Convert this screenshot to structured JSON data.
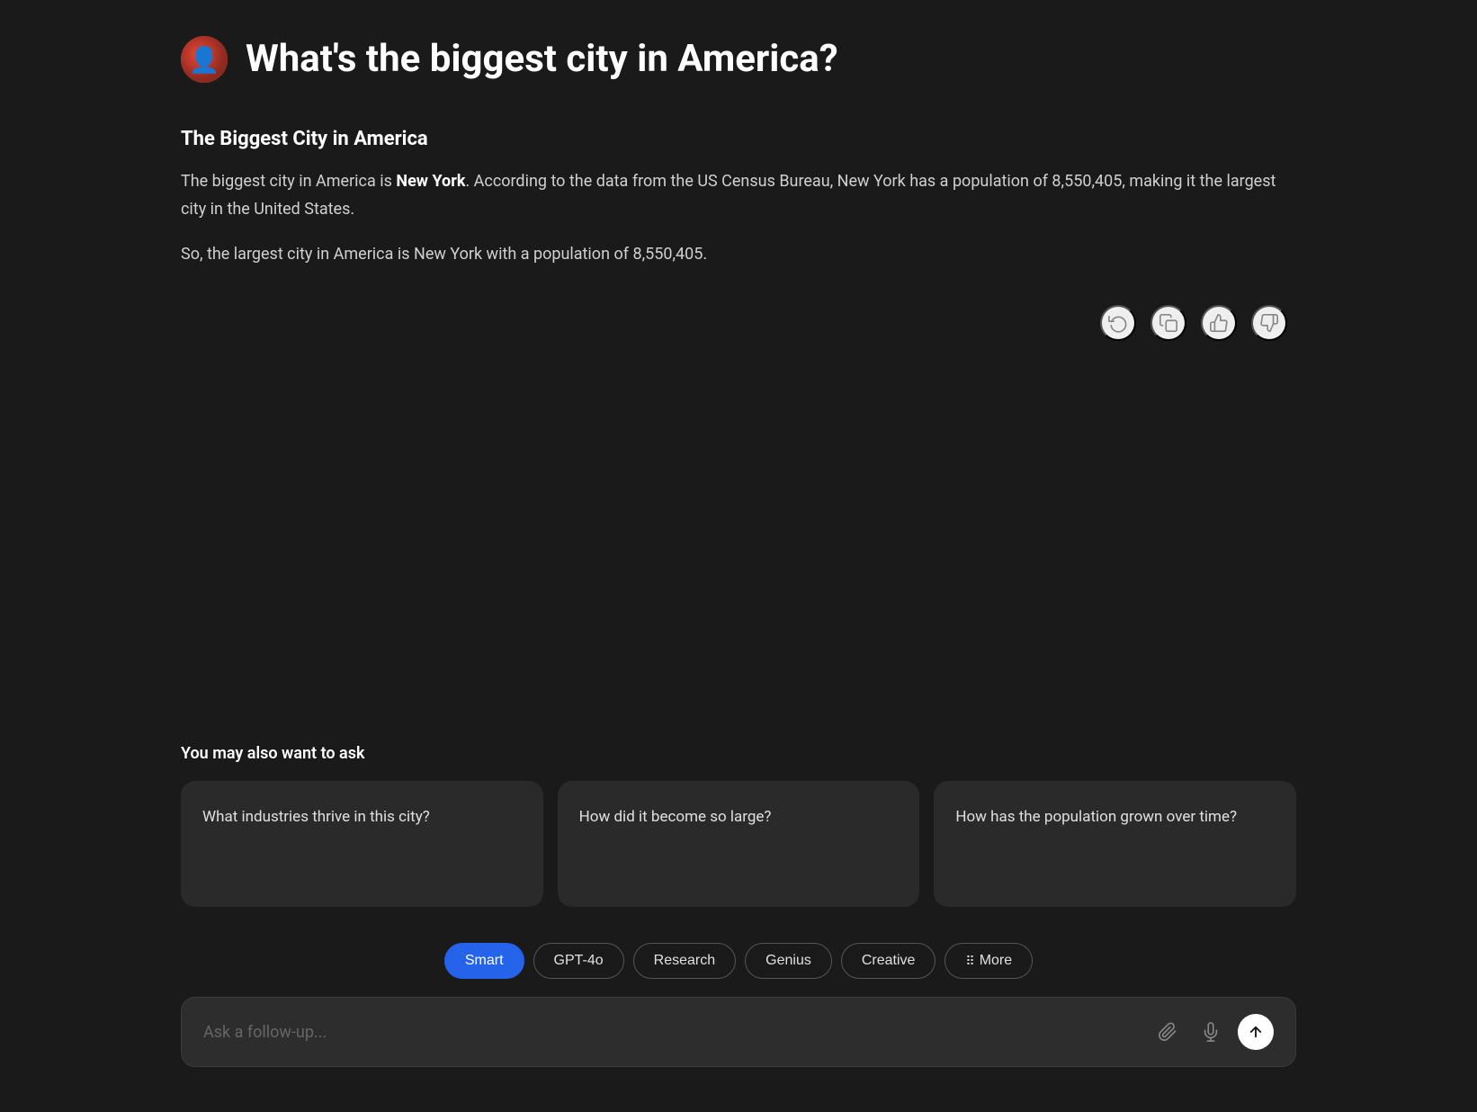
{
  "header": {
    "question": "What's the biggest city in America?"
  },
  "answer": {
    "heading": "The Biggest City in America",
    "paragraph1_before": "The biggest city in America is ",
    "paragraph1_bold": "New York",
    "paragraph1_after": ". According to the data from the US Census Bureau, New York has a population of 8,550,405, making it the largest city in the United States.",
    "paragraph2": "So, the largest city in America is New York with a population of 8,550,405."
  },
  "action_icons": {
    "regenerate": "regenerate-icon",
    "copy": "copy-icon",
    "thumbs_up": "thumbs-up-icon",
    "thumbs_down": "thumbs-down-icon"
  },
  "suggestions": {
    "title": "You may also want to ask",
    "items": [
      {
        "text": "What industries thrive in this city?"
      },
      {
        "text": "How did it become so large?"
      },
      {
        "text": "How has the population grown over time?"
      }
    ]
  },
  "model_buttons": [
    {
      "id": "smart",
      "label": "Smart",
      "active": true
    },
    {
      "id": "gpt4o",
      "label": "GPT-4o",
      "active": false
    },
    {
      "id": "research",
      "label": "Research",
      "active": false
    },
    {
      "id": "genius",
      "label": "Genius",
      "active": false
    },
    {
      "id": "creative",
      "label": "Creative",
      "active": false
    },
    {
      "id": "more",
      "label": "More",
      "active": false,
      "has_icon": true
    }
  ],
  "input": {
    "placeholder": "Ask a follow-up..."
  }
}
